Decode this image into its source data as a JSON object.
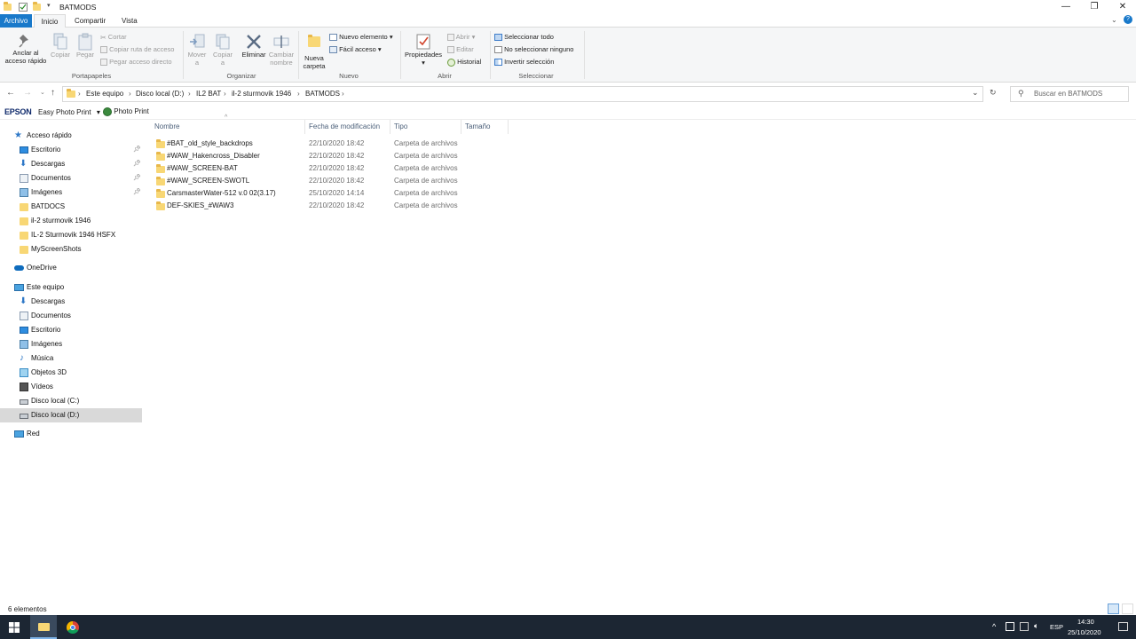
{
  "window": {
    "title": "BATMODS",
    "minimize_glyph": "—",
    "maximize_glyph": "❐",
    "close_glyph": "✕"
  },
  "ribbon_tabs": {
    "file": "Archivo",
    "home": "Inicio",
    "share": "Compartir",
    "view": "Vista"
  },
  "ribbon": {
    "portapapeles": {
      "label": "Portapapeles",
      "pin": "Anclar al acceso rápido",
      "pin_line1": "Anclar al",
      "pin_line2": "acceso rápido",
      "copy": "Copiar",
      "paste": "Pegar",
      "cut": "Cortar",
      "copy_path": "Copiar ruta de acceso",
      "paste_shortcut": "Pegar acceso directo"
    },
    "organizar": {
      "label": "Organizar",
      "move_line1": "Mover",
      "move_line2": "a",
      "copy_line1": "Copiar",
      "copy_line2": "a",
      "delete": "Eliminar",
      "rename_line1": "Cambiar",
      "rename_line2": "nombre"
    },
    "nuevo": {
      "label": "Nuevo",
      "new_folder_line1": "Nueva",
      "new_folder_line2": "carpeta",
      "new_item": "Nuevo elemento",
      "easy_access": "Fácil acceso"
    },
    "abrir": {
      "label": "Abrir",
      "properties": "Propiedades",
      "open": "Abrir",
      "edit": "Editar",
      "history": "Historial"
    },
    "seleccionar": {
      "label": "Seleccionar",
      "select_all": "Seleccionar todo",
      "select_none": "No seleccionar ninguno",
      "invert": "Invertir selección"
    }
  },
  "address": {
    "crumbs": [
      "Este equipo",
      "Disco local (D:)",
      "IL2 BAT",
      "il-2 sturmovik 1946",
      "BATMODS"
    ],
    "search_placeholder": "Buscar en BATMODS"
  },
  "epson": {
    "brand": "EPSON",
    "easy_photo_print": "Easy Photo Print",
    "photo_print": "Photo Print"
  },
  "nav": {
    "quick_access": "Acceso rápido",
    "quick_items": [
      {
        "label": "Escritorio",
        "icon": "desktop-icon",
        "pinned": true
      },
      {
        "label": "Descargas",
        "icon": "download-icon",
        "pinned": true
      },
      {
        "label": "Documentos",
        "icon": "documents-icon",
        "pinned": true
      },
      {
        "label": "Imágenes",
        "icon": "pictures-icon",
        "pinned": true
      },
      {
        "label": "BATDOCS",
        "icon": "folder-icon",
        "pinned": false
      },
      {
        "label": "il-2 sturmovik 1946",
        "icon": "folder-icon",
        "pinned": false
      },
      {
        "label": "IL-2 Sturmovik 1946 HSFX",
        "icon": "folder-icon",
        "pinned": false
      },
      {
        "label": "MyScreenShots",
        "icon": "folder-icon",
        "pinned": false
      }
    ],
    "onedrive": "OneDrive",
    "this_pc": "Este equipo",
    "pc_items": [
      {
        "label": "Descargas",
        "icon": "download-icon"
      },
      {
        "label": "Documentos",
        "icon": "documents-icon"
      },
      {
        "label": "Escritorio",
        "icon": "desktop-icon"
      },
      {
        "label": "Imágenes",
        "icon": "pictures-icon"
      },
      {
        "label": "Música",
        "icon": "music-icon"
      },
      {
        "label": "Objetos 3D",
        "icon": "3d-objects-icon"
      },
      {
        "label": "Vídeos",
        "icon": "videos-icon"
      },
      {
        "label": "Disco local (C:)",
        "icon": "drive-icon"
      },
      {
        "label": "Disco local (D:)",
        "icon": "drive-icon"
      }
    ],
    "network": "Red"
  },
  "columns": {
    "name": "Nombre",
    "modified": "Fecha de modificación",
    "type": "Tipo",
    "size": "Tamaño"
  },
  "files": [
    {
      "name": "#BAT_old_style_backdrops",
      "modified": "22/10/2020 18:42",
      "type": "Carpeta de archivos"
    },
    {
      "name": "#WAW_Hakencross_Disabler",
      "modified": "22/10/2020 18:42",
      "type": "Carpeta de archivos"
    },
    {
      "name": "#WAW_SCREEN-BAT",
      "modified": "22/10/2020 18:42",
      "type": "Carpeta de archivos"
    },
    {
      "name": "#WAW_SCREEN-SWOTL",
      "modified": "22/10/2020 18:42",
      "type": "Carpeta de archivos"
    },
    {
      "name": "CarsmasterWater-512 v.0 02(3.17)",
      "modified": "25/10/2020 14:14",
      "type": "Carpeta de archivos"
    },
    {
      "name": "DEF-SKIES_#WAW3",
      "modified": "22/10/2020 18:42",
      "type": "Carpeta de archivos"
    }
  ],
  "status": {
    "count": "6 elementos"
  },
  "taskbar": {
    "lang": "ESP",
    "time": "14:30",
    "date": "25/10/2020",
    "tray_up": "^"
  },
  "colors": {
    "accent": "#1979ca",
    "folder": "#f8d775",
    "taskbar": "#1c2633",
    "selected": "#d9d9d9"
  }
}
